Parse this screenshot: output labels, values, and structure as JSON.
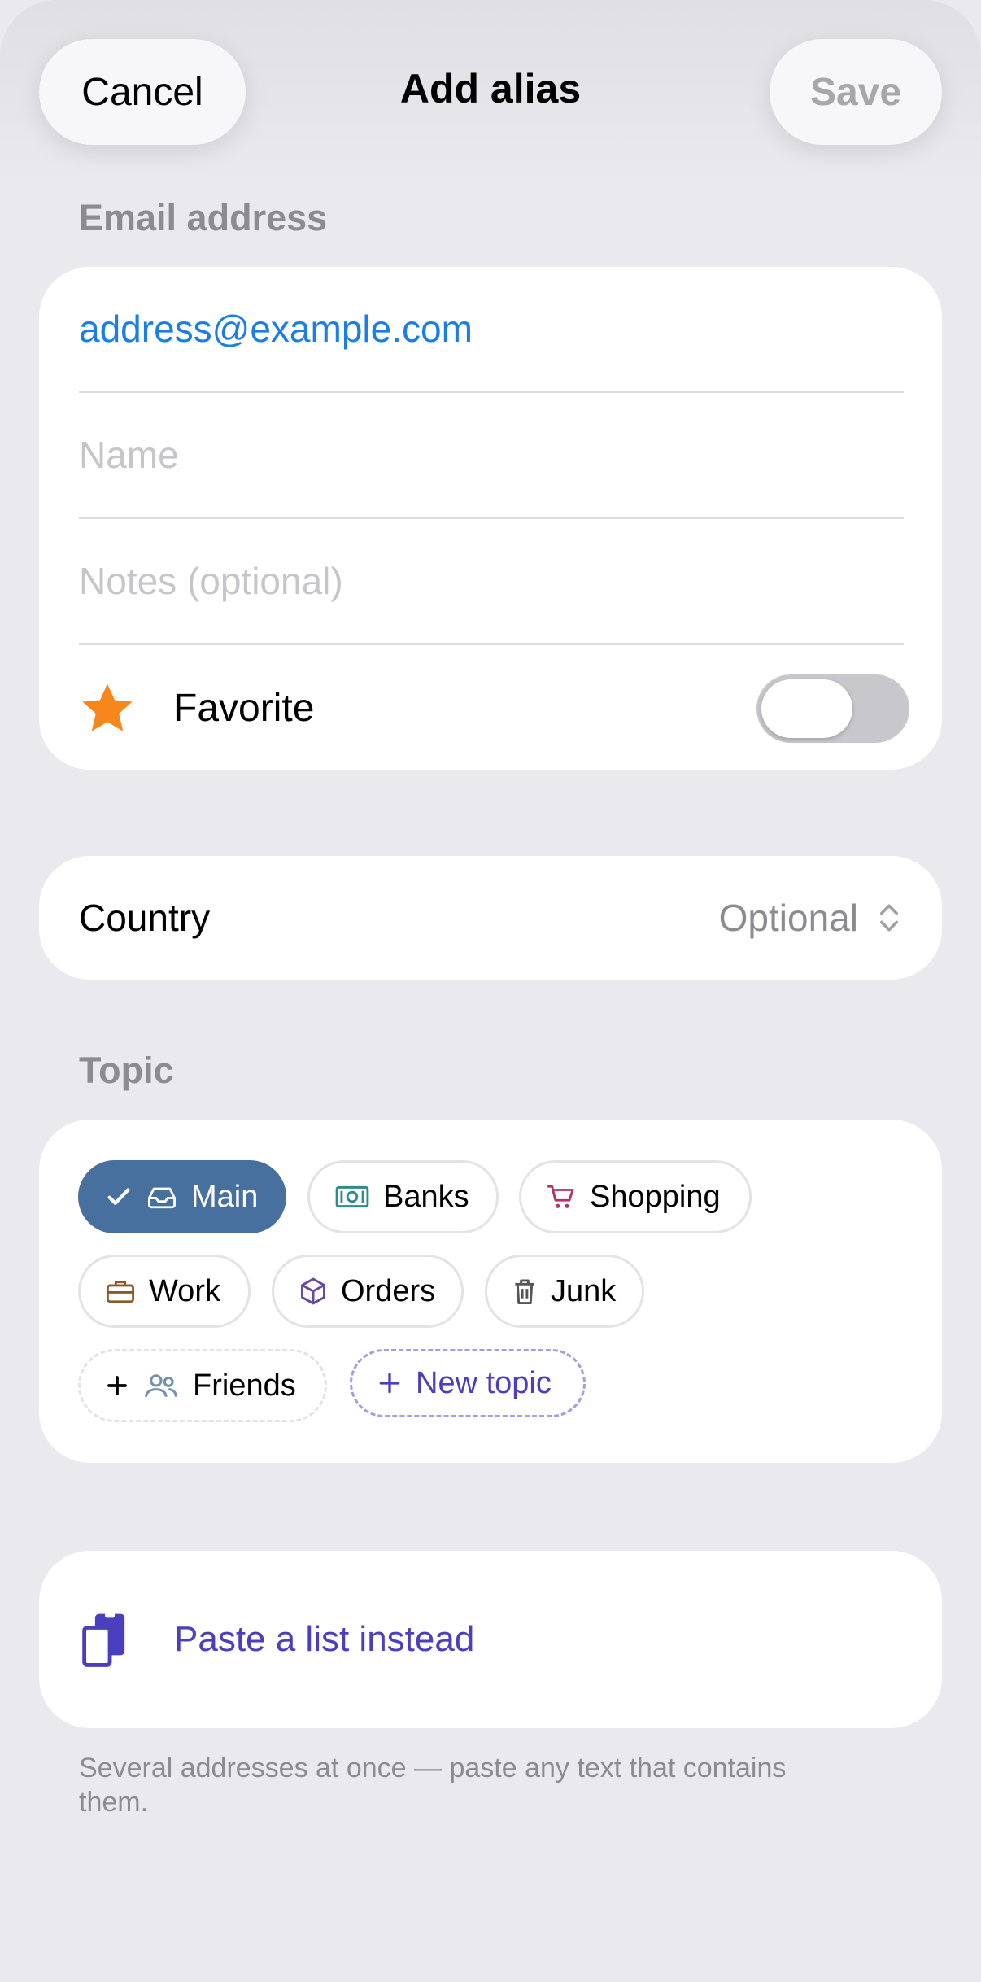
{
  "header": {
    "cancel_label": "Cancel",
    "title": "Add alias",
    "save_label": "Save"
  },
  "email_section": {
    "label": "Email address",
    "email_value": "address@example.com",
    "name_placeholder": "Name",
    "notes_placeholder": "Notes (optional)",
    "favorite_label": "Favorite",
    "favorite_on": false
  },
  "country": {
    "label": "Country",
    "value": "Optional"
  },
  "topic": {
    "label": "Topic",
    "chips": [
      {
        "label": "Main",
        "icon": "inbox-icon",
        "selected": true
      },
      {
        "label": "Banks",
        "icon": "banknote-icon",
        "selected": false
      },
      {
        "label": "Shopping",
        "icon": "cart-icon",
        "selected": false
      },
      {
        "label": "Work",
        "icon": "briefcase-icon",
        "selected": false
      },
      {
        "label": "Orders",
        "icon": "box-icon",
        "selected": false
      },
      {
        "label": "Junk",
        "icon": "trash-icon",
        "selected": false
      },
      {
        "label": "Friends",
        "icon": "people-icon",
        "selected": false
      }
    ],
    "new_topic_label": "New topic"
  },
  "paste": {
    "label": "Paste a list instead",
    "footnote": "Several addresses at once — paste any text that contains them."
  },
  "colors": {
    "accent_blue": "#1a7ee6",
    "selected_chip": "#47709e",
    "purple": "#4b3fbf",
    "star": "#f7871d"
  }
}
